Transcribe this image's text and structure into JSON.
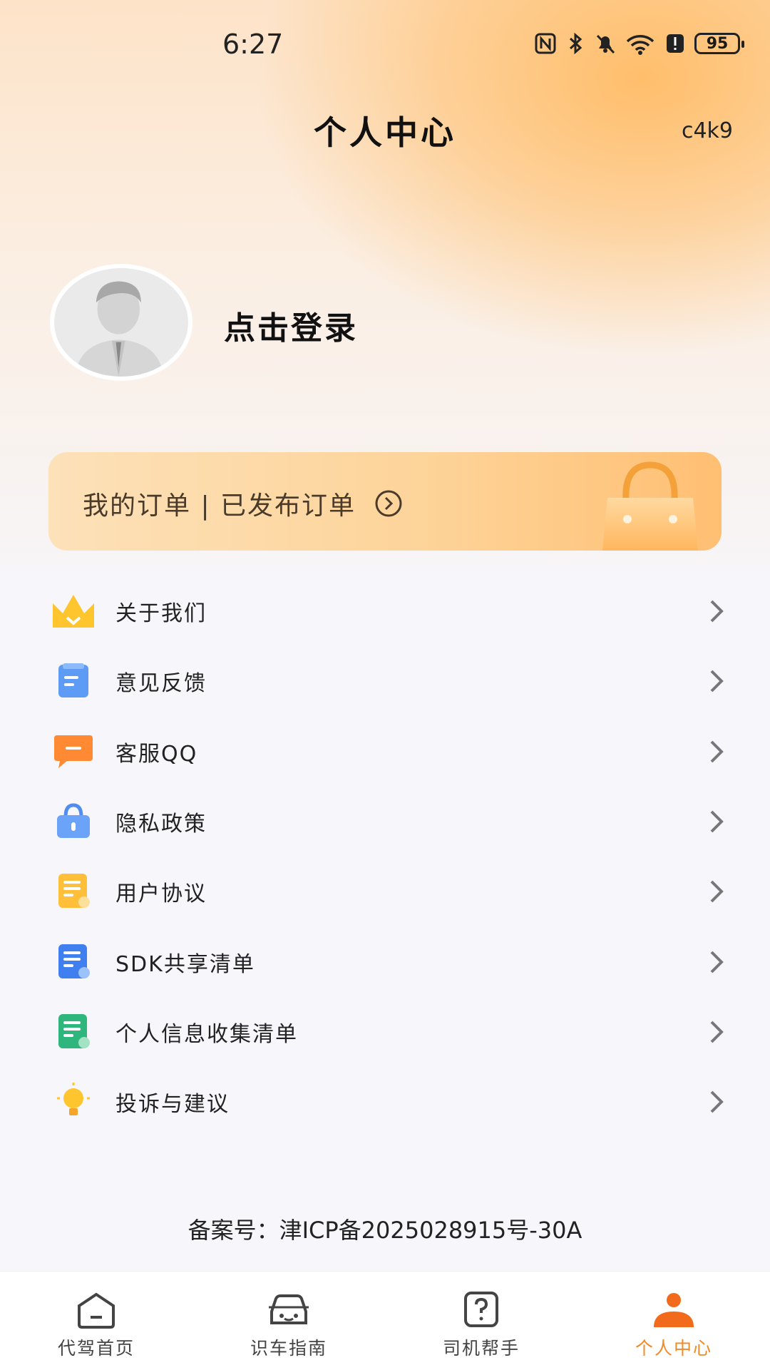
{
  "status_bar": {
    "time": "6:27",
    "battery": "95",
    "icons": [
      "nfc-icon",
      "bluetooth-icon",
      "bell-off-icon",
      "wifi-icon",
      "alert-icon",
      "battery-icon"
    ]
  },
  "header": {
    "title": "个人中心",
    "code": "c4k9"
  },
  "profile": {
    "login_text": "点击登录"
  },
  "order_card": {
    "text": "我的订单 | 已发布订单"
  },
  "menu": {
    "items": [
      {
        "label": "关于我们",
        "icon": "crown-icon"
      },
      {
        "label": "意见反馈",
        "icon": "clipboard-icon"
      },
      {
        "label": "客服QQ",
        "icon": "chat-bubble-icon"
      },
      {
        "label": "隐私政策",
        "icon": "lock-bag-icon"
      },
      {
        "label": "用户协议",
        "icon": "document-icon"
      },
      {
        "label": "SDK共享清单",
        "icon": "list-user-icon"
      },
      {
        "label": "个人信息收集清单",
        "icon": "info-list-icon"
      },
      {
        "label": "投诉与建议",
        "icon": "lightbulb-icon"
      }
    ]
  },
  "footer": {
    "icp": "备案号：津ICP备2025028915号-30A"
  },
  "tabbar": {
    "tabs": [
      {
        "label": "代驾首页",
        "icon": "home-icon"
      },
      {
        "label": "识车指南",
        "icon": "car-icon"
      },
      {
        "label": "司机帮手",
        "icon": "help-icon"
      },
      {
        "label": "个人中心",
        "icon": "person-icon"
      }
    ],
    "active_index": 3
  },
  "colors": {
    "accent": "#f08a24",
    "header_gradient": "#ffbe6b",
    "card_gradient_start": "#fde1b9",
    "card_gradient_end": "#ffbf73"
  }
}
